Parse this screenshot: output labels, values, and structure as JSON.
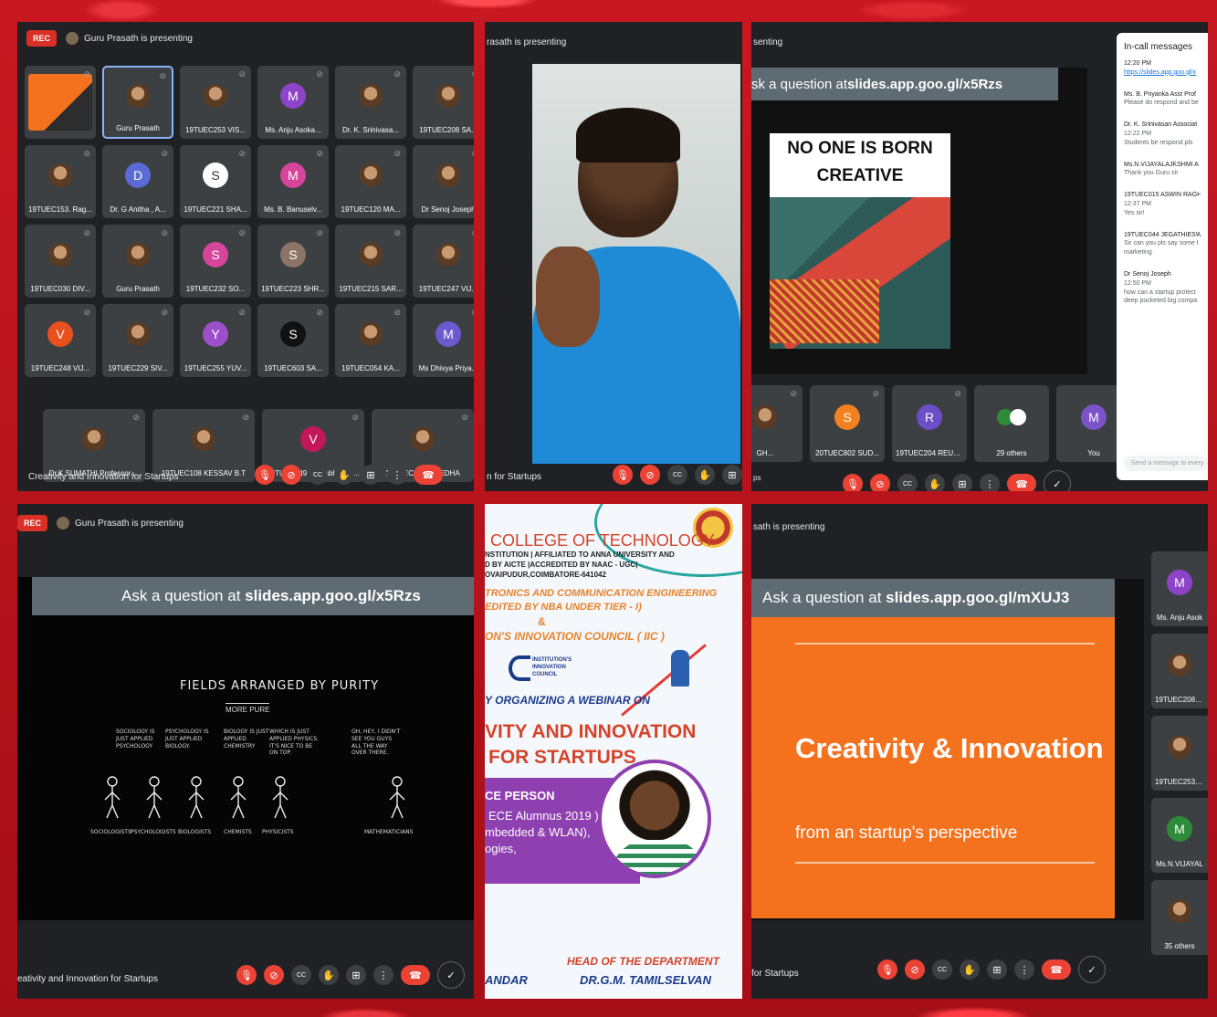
{
  "common": {
    "rec": "REC",
    "presenting": "Guru Prasath is presenting",
    "presenting_cut": "rasath is presenting",
    "presenting_cut2": "senting",
    "presenting_cut3": "sath is presenting",
    "meeting_title": "Creativity and Innovation for Startups",
    "meeting_title_cut": "n for Startups",
    "meeting_title_cut2": "eativity and Innovation for Startups",
    "meeting_title_cut3": "for Startups",
    "meeting_title_cut4": "ps",
    "colors": {
      "accent": "#8ab4f8",
      "red": "#ea4335",
      "tile": "#3c4043",
      "panel": "#202124",
      "orange": "#f4721e"
    }
  },
  "controls": {
    "mic": "🎙",
    "cam": "⊘",
    "cc": "CC",
    "hand": "✋",
    "present": "⊞",
    "more": "⋮",
    "end": "☎",
    "check": "✓"
  },
  "grid_tiles": [
    {
      "name": "",
      "kind": "screen"
    },
    {
      "name": "Guru Prasath",
      "kind": "photo",
      "active": true
    },
    {
      "name": "19TUEC253 VIS...",
      "kind": "photo"
    },
    {
      "name": "Ms. Anju Asoka...",
      "kind": "avatar",
      "letter": "M",
      "color": "#8e44c9"
    },
    {
      "name": "Dr. K. Srinivasa...",
      "kind": "photo"
    },
    {
      "name": "19TUEC208 SA...",
      "kind": "photo"
    },
    {
      "name": "19TUEC153. Rag...",
      "kind": "photo"
    },
    {
      "name": "Dr. G Anitha , A...",
      "kind": "avatar",
      "letter": "D",
      "color": "#5b6bd6"
    },
    {
      "name": "19TUEC221 SHA...",
      "kind": "avatar",
      "letter": "S",
      "color": "#ffffff"
    },
    {
      "name": "Ms. B. Banuselv...",
      "kind": "avatar",
      "letter": "M",
      "color": "#d6459a"
    },
    {
      "name": "19TUEC120 MA...",
      "kind": "photo"
    },
    {
      "name": "Dr Senoj Joseph",
      "kind": "photo"
    },
    {
      "name": "19TUEC030 DIV...",
      "kind": "photo"
    },
    {
      "name": "Guru Prasath",
      "kind": "photo"
    },
    {
      "name": "19TUEC232 SO...",
      "kind": "avatar",
      "letter": "S",
      "color": "#d6459a"
    },
    {
      "name": "19TUEC223 SHR...",
      "kind": "avatar",
      "letter": "S",
      "color": "#8d7468"
    },
    {
      "name": "19TUEC215 SAR...",
      "kind": "photo"
    },
    {
      "name": "19TUEC247 VIJ...",
      "kind": "photo"
    },
    {
      "name": "19TUEC248 VIJ...",
      "kind": "avatar",
      "letter": "V",
      "color": "#e8501e"
    },
    {
      "name": "19TUEC229 SIV...",
      "kind": "photo"
    },
    {
      "name": "19TUEC255 YUV...",
      "kind": "avatar",
      "letter": "Y",
      "color": "#9b4fc8"
    },
    {
      "name": "19TUEC603 SA...",
      "kind": "avatar",
      "letter": "S",
      "color": "#111111"
    },
    {
      "name": "19TUEC054 KA...",
      "kind": "photo"
    },
    {
      "name": "Ms Dhivya Priya...",
      "kind": "avatar",
      "letter": "M",
      "color": "#6a5acd"
    }
  ],
  "grid_row5": [
    {
      "name": "Dr.K.SUMATHI Professor ...",
      "kind": "photo"
    },
    {
      "name": "19TUEC108 KESSAV B.T",
      "kind": "photo"
    },
    {
      "name": "19TUEC249 Vijayabharath...",
      "kind": "avatar",
      "letter": "V",
      "color": "#c2185b"
    },
    {
      "name": "19TUEC241 SWEDHA",
      "kind": "photo"
    }
  ],
  "slides": {
    "ask1_prefix": "sk a question at ",
    "ask1_link": "slides.app.goo.gl/x5Rzs",
    "creative_line1": "NO ONE IS BORN",
    "creative_line2": "CREATIVE",
    "ask2_prefix": "Ask a question at ",
    "ask2_link": "slides.app.goo.gl/x5Rzs",
    "ask3_prefix": "Ask a question at ",
    "ask3_link": "slides.app.goo.gl/mXUJ3",
    "xkcd_title": "FIELDS ARRANGED BY PURITY",
    "xkcd_sub": "MORE PURE",
    "orange_title": "Creativity & Innovation",
    "orange_sub": "from an startup's perspective",
    "xkcd_quotes": [
      "SOCIOLOGY IS JUST APPLIED PSYCHOLOGY",
      "PSYCHOLOGY IS JUST APPLIED BIOLOGY.",
      "BIOLOGY IS JUST APPLIED CHEMISTRY",
      "WHICH IS JUST APPLIED PHYSICS. IT'S NICE TO BE ON TOP.",
      "OH, HEY, I DIDN'T SEE YOU GUYS ALL THE WAY OVER THERE."
    ],
    "xkcd_labels": [
      "SOCIOLOGISTS",
      "PSYCHOLOGISTS",
      "BIOLOGISTS",
      "CHEMISTS",
      "PHYSICISTS",
      "MATHEMATICIANS"
    ]
  },
  "chat": {
    "title": "In-call messages",
    "messages": [
      {
        "who": "12:20 PM",
        "text": "https://slides.app.goo.gl/x",
        "link": true
      },
      {
        "who": "Ms. B. Priyanka Asst Prof",
        "text": "Please do respond and be"
      },
      {
        "who": "Dr. K. Srinivasan Associat",
        "time": "12:22 PM",
        "text": "Students be respond pls"
      },
      {
        "who": "Ms.N.VIJAYALAJKSHMI A",
        "text": "Thank you Guru sir"
      },
      {
        "who": "19TUEC015 ASWIN RAGH",
        "time": "12:37 PM",
        "text": "Yes sir!"
      },
      {
        "who": "19TUEC044 JEGATHIESW",
        "text": "Sir can you pls say some t",
        "text2": "marketing"
      },
      {
        "who": "Dr Senoj Joseph",
        "time": "12:50 PM",
        "text": "how can a startup protect",
        "text2": "deep pocketed big compa"
      }
    ],
    "input_placeholder": "Send a message to every"
  },
  "panel3_tiles": [
    {
      "name": "GH...",
      "kind": "photo"
    },
    {
      "name": "20TUEC802 SUD...",
      "kind": "avatar",
      "letter": "S",
      "color": "#f4811f"
    },
    {
      "name": "19TUEC204 REUB...",
      "kind": "avatar",
      "letter": "R",
      "color": "#6a4fc8"
    },
    {
      "name": "29 others",
      "kind": "others"
    },
    {
      "name": "You",
      "kind": "avatar",
      "letter": "M",
      "color": "#7b52c8"
    }
  ],
  "panel6_tiles": [
    {
      "name": "Ms. Anju Asok",
      "kind": "avatar",
      "letter": "M",
      "color": "#8e44c9"
    },
    {
      "name": "19TUEC208 SA",
      "kind": "photo"
    },
    {
      "name": "19TUEC253 VIS",
      "kind": "photo"
    },
    {
      "name": "Ms.N.VIJAYAL",
      "kind": "avatar",
      "letter": "M",
      "color": "#2e8b3a"
    },
    {
      "name": "35 others",
      "kind": "photo"
    }
  ],
  "poster": {
    "college": "COLLEGE OF TECHNOLOGY",
    "line1": "NSTITUTION | AFFILIATED TO ANNA UNIVERSITY AND",
    "line2": "D BY AICTE |ACCREDITED BY NAAC - UGC|",
    "line3": "OVAIPUDUR,COIMBATORE-641042",
    "dept1": "TRONICS AND COMMUNICATION ENGINEERING",
    "dept2": "EDITED BY NBA UNDER TIER - I)",
    "amp": "&",
    "council": "ON'S INNOVATION COUNCIL ( IIC )",
    "iic": "INSTITUTION'S INNOVATION COUNCIL",
    "organizing": "Y ORGANIZING A WEBINAR ON",
    "title1": "VITY AND INNOVATION",
    "title2": "FOR STARTUPS",
    "resource": "CE PERSON",
    "alumnus": "ECE Alumnus 2019 )",
    "spec": "mbedded & WLAN),",
    "tech": "ogies,",
    "hod_label": "HEAD OF THE DEPARTMENT",
    "hod_name": "DR.G.M. TAMILSELVAN",
    "left_name": "ANDAR"
  }
}
